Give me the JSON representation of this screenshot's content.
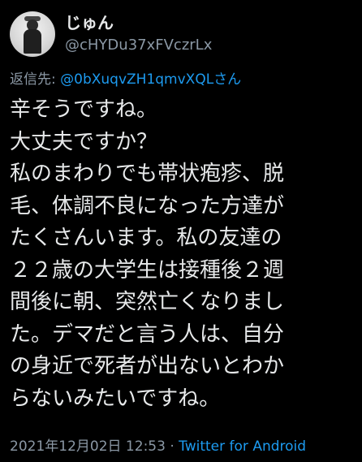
{
  "user": {
    "display_name": "じゅん",
    "handle": "@cHYDu37xFVczrLx"
  },
  "reply": {
    "prefix": "返信先: ",
    "mention": "@0bXuqvZH1qmvXQLさん"
  },
  "tweet": {
    "text": "辛そうですね。\n大丈夫ですか？\n私のまわりでも帯状疱疹、脱\n毛、体調不良になった方達が\nたくさんいます。私の友達の\n２２歳の大学生は接種後２週\n間後に朝、突然亡くなりまし\nた。デマだと言う人は、自分\nの身近で死者が出ないとわか\nらないみたいですね。"
  },
  "meta": {
    "timestamp": "2021年12月02日 12:53",
    "separator": " · ",
    "source": "Twitter for Android"
  },
  "colors": {
    "background": "#000000",
    "text": "#e7e9ea",
    "muted": "#8b98a5",
    "accent": "#1d9bf0"
  }
}
